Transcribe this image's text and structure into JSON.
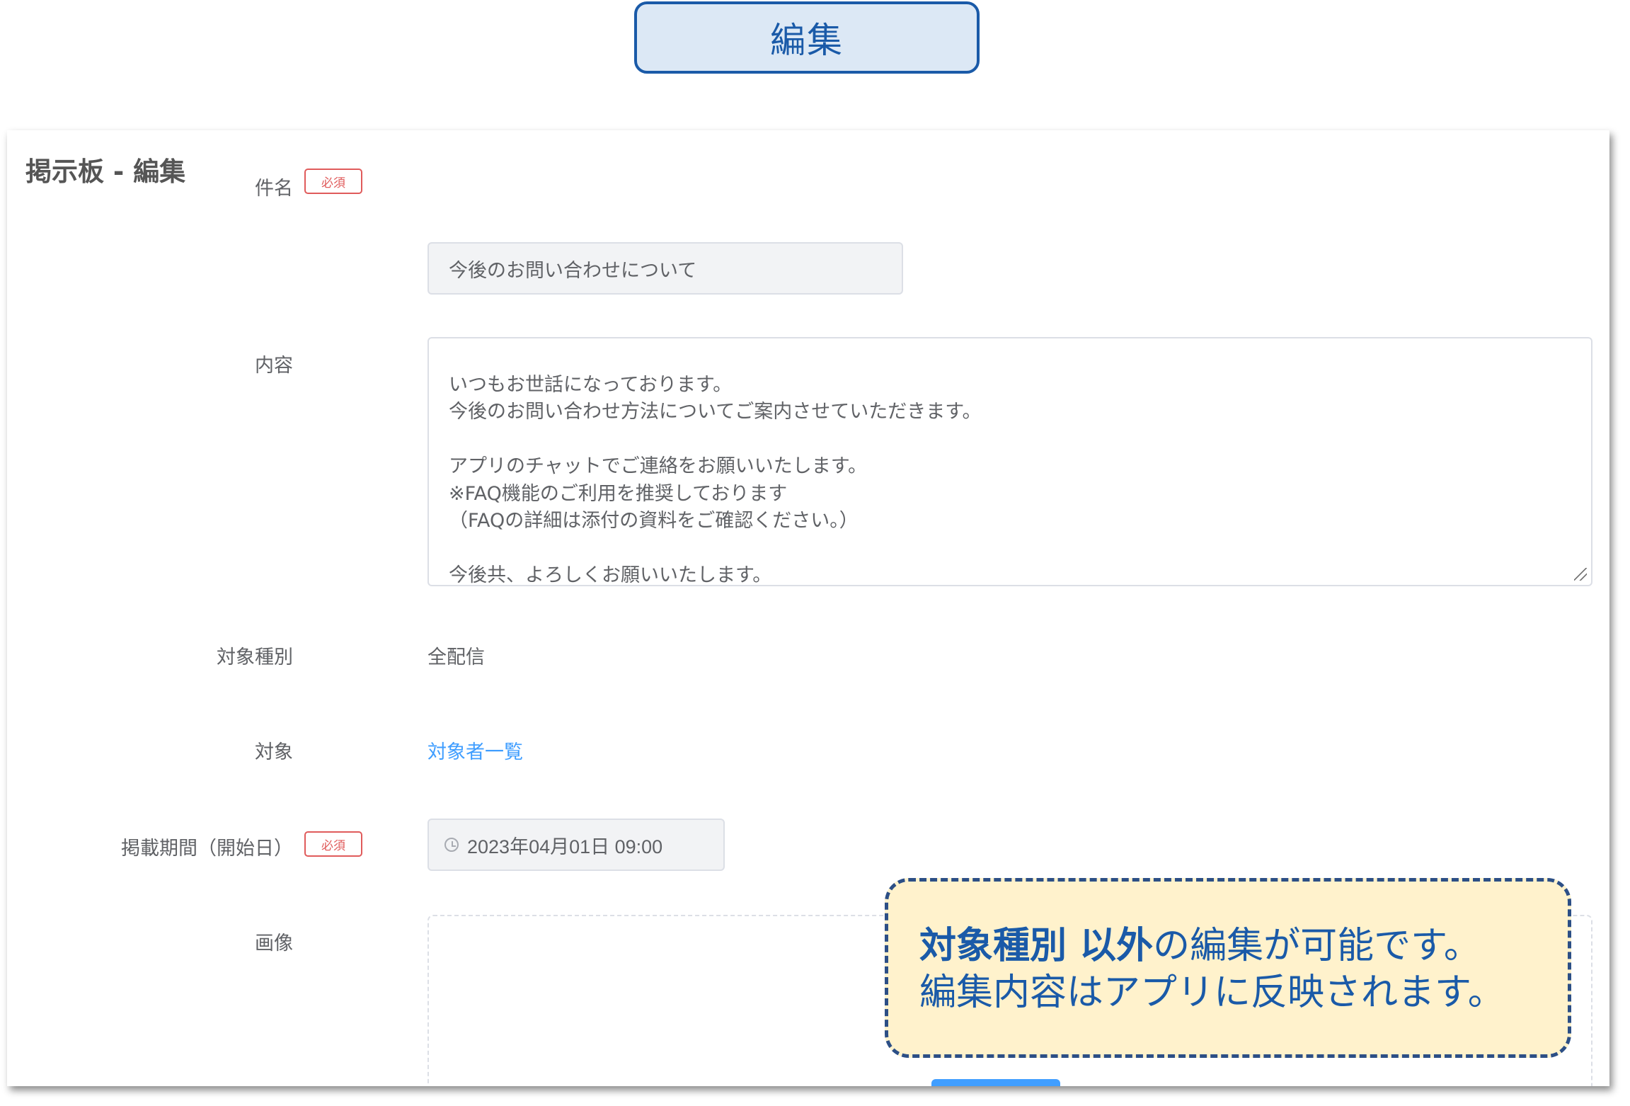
{
  "top_badge": {
    "label": "編集"
  },
  "card": {
    "title": "掲示板 - 編集"
  },
  "required_label": "必須",
  "form": {
    "subject": {
      "label": "件名",
      "value": "今後のお問い合わせについて"
    },
    "content": {
      "label": "内容",
      "value": "いつもお世話になっております。\n今後のお問い合わせ方法についてご案内させていただきます。\n\nアプリのチャットでご連絡をお願いいたします。\n※FAQ機能のご利用を推奨しております\n（FAQの詳細は添付の資料をご確認ください。）\n\n今後共、よろしくお願いいたします。"
    },
    "target_type": {
      "label": "対象種別",
      "value": "全配信"
    },
    "target": {
      "label": "対象",
      "link": "対象者一覧"
    },
    "period_start": {
      "label": "掲載期間（開始日）",
      "value": "2023年04月01日 09:00",
      "icon": "clock-icon"
    },
    "image": {
      "label": "画像"
    }
  },
  "callout": {
    "line1_bold": "対象種別 以外",
    "line1_rest": "の編集が可能です。",
    "line2": "編集内容はアプリに反映されます。"
  },
  "colors": {
    "accent": "#1a5aa8",
    "badge_bg": "#dce8f5",
    "required": "#e05b5b",
    "link": "#409eff",
    "callout_bg": "#fff2cc",
    "callout_border": "#2c4f86"
  }
}
